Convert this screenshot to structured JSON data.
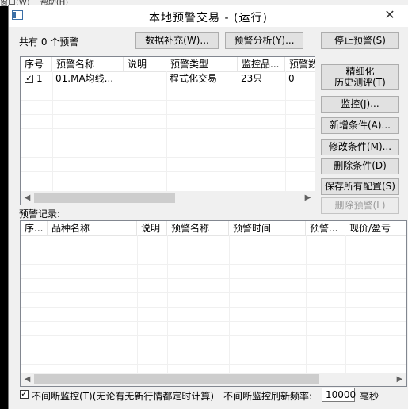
{
  "background_menu": [
    "窗口(W)",
    "帮助(H)"
  ],
  "window": {
    "title": "本地预警交易 - (运行)",
    "close_glyph": "✕"
  },
  "summary": "共有 0 个预警",
  "buttons": {
    "supplement": "数据补充(W)...",
    "analysis": "预警分析(Y)...",
    "stop": "停止预警(S)",
    "refine_line1": "精细化",
    "refine_line2": "历史测评(T)",
    "monitor": "监控(J)...",
    "add_condition": "新增条件(A)...",
    "edit_condition": "修改条件(M)...",
    "delete_condition": "删除条件(D)",
    "save_config": "保存所有配置(S)",
    "delete_alert": "删除预警(L)"
  },
  "conditions_table": {
    "columns": [
      "序号",
      "预警名称",
      "说明",
      "预警类型",
      "监控品...",
      "预警数"
    ],
    "rows": [
      {
        "checked": true,
        "index": "1",
        "name": "01.MA均线...",
        "desc": "",
        "type": "程式化交易",
        "monitor": "23只",
        "count": "0"
      }
    ]
  },
  "records_label": "预警记录:",
  "records_table": {
    "columns": [
      "序...",
      "品种名称",
      "说明",
      "预警名称",
      "预警时间",
      "预警...",
      "现价/盈亏"
    ]
  },
  "footer": {
    "continuous_checked": true,
    "continuous_label": "不间断监控(T)(无论有无新行情都定时计算)",
    "refresh_label": "不间断监控刷新频率:",
    "refresh_value": "10000",
    "unit": "毫秒"
  },
  "scroll_arrows": {
    "left": "◀",
    "right": "▶"
  },
  "colors": {
    "window_bg": "#f0f0f0",
    "button_bg": "#e1e1e1",
    "disabled_text": "#9a9a9a"
  }
}
